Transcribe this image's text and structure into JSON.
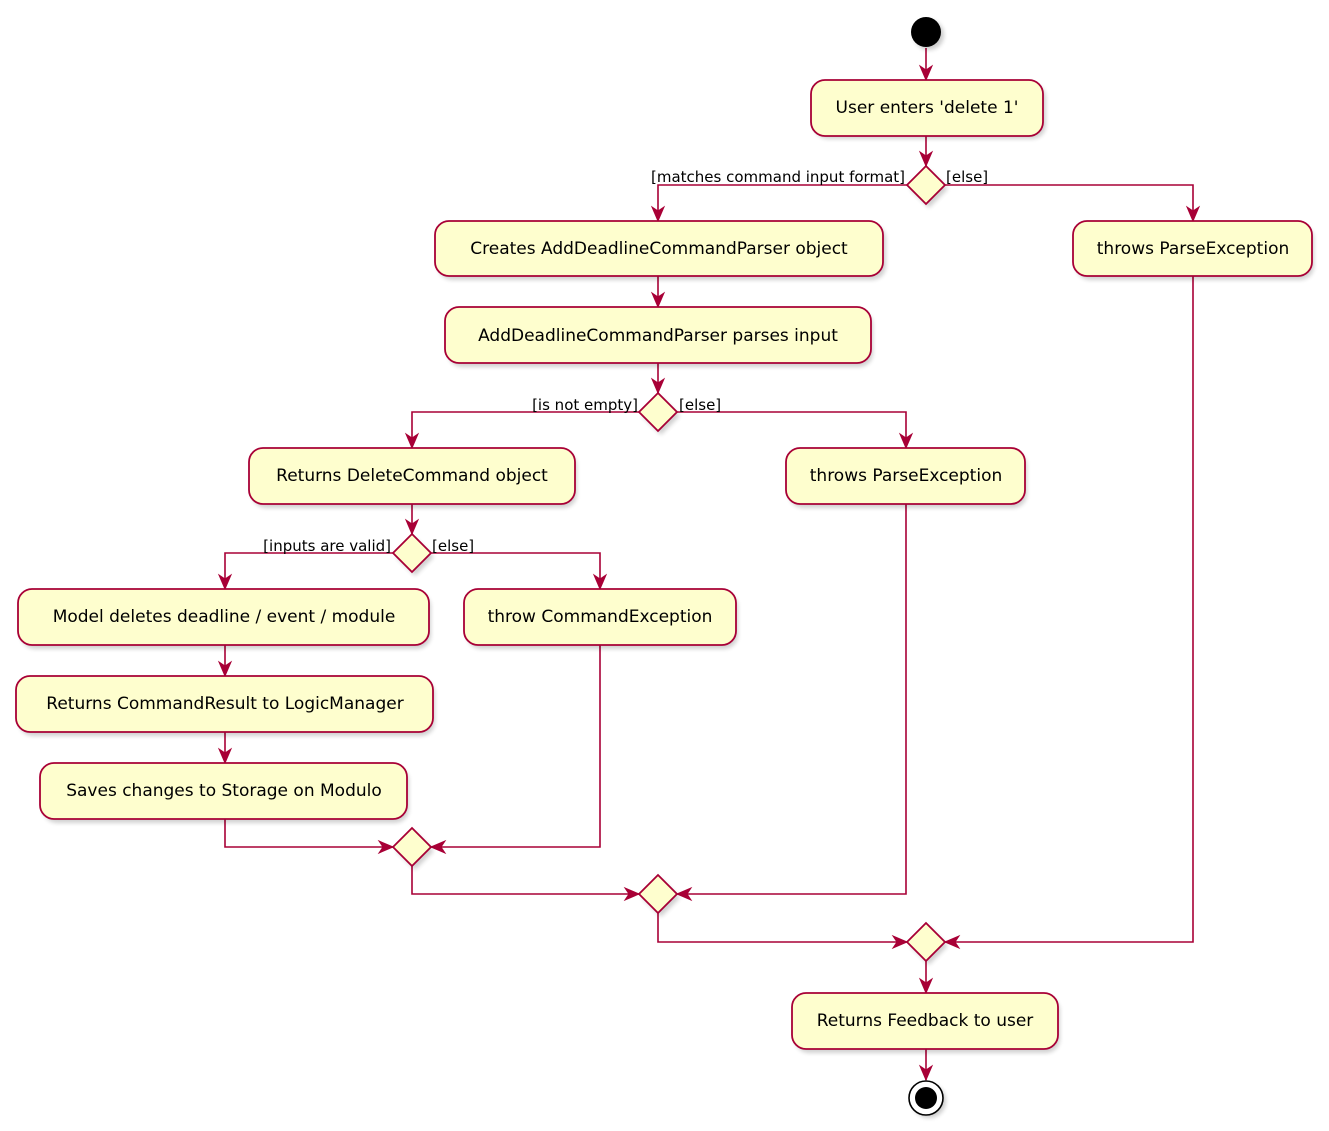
{
  "diagram": {
    "type": "uml-activity",
    "colors": {
      "line": "#A80036",
      "fill": "#FEFECE",
      "start": "#000000"
    },
    "activities": {
      "user_enters": "User enters 'delete 1'",
      "creates_parser": "Creates AddDeadlineCommandParser object",
      "parser_parses": "AddDeadlineCommandParser parses input",
      "returns_delete_command": "Returns DeleteCommand object",
      "model_deletes": "Model deletes deadline / event / module",
      "returns_command_result": "Returns CommandResult to LogicManager",
      "saves_changes": "Saves changes to Storage on Modulo",
      "throw_command_exception": "throw CommandException",
      "throws_parse_exception_inner": "throws ParseException",
      "throws_parse_exception_outer": "throws ParseException",
      "returns_feedback": "Returns Feedback to user"
    },
    "guards": {
      "matches_format": "[matches command input format]",
      "else_1": "[else]",
      "is_not_empty": "[is not empty]",
      "else_2": "[else]",
      "inputs_valid": "[inputs are valid]",
      "else_3": "[else]"
    }
  }
}
